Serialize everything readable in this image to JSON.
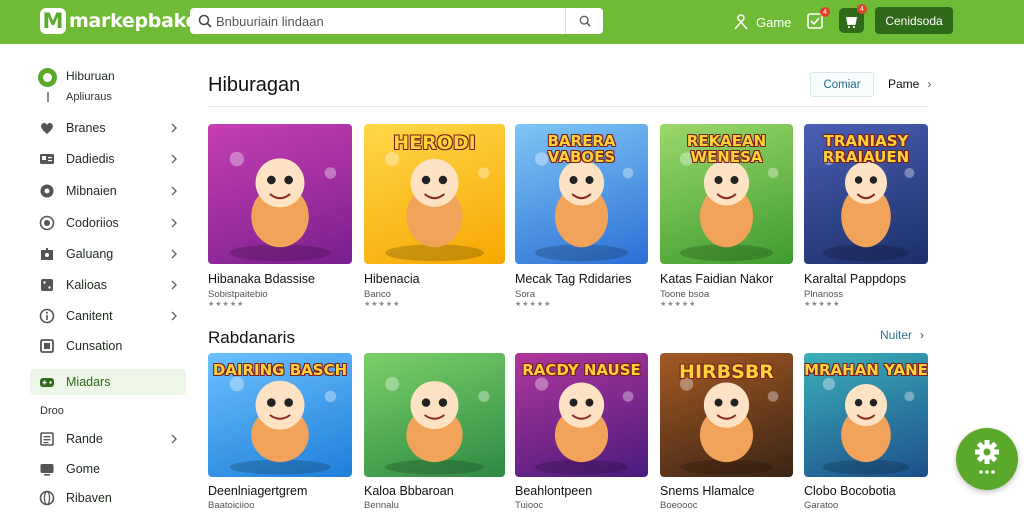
{
  "header": {
    "logo_mark": "M",
    "logo_text": "markepbake",
    "search_placeholder": "Bnbuuriain lindaan",
    "game_link": "Game",
    "notif_badge": "4",
    "cart_badge": "4",
    "cta_label": "Cenidsoda"
  },
  "sidebar": {
    "profile_name": "Hiburuan",
    "profile_sub": "Apliuraus",
    "items": [
      {
        "label": "Branes",
        "icon": "heart-icon",
        "chevron": true
      },
      {
        "label": "Dadiedis",
        "icon": "id-card-icon",
        "chevron": true
      },
      {
        "label": "Mibnaien",
        "icon": "chat-icon",
        "chevron": true
      },
      {
        "label": "Codoriios",
        "icon": "target-icon",
        "chevron": true
      },
      {
        "label": "Galuang",
        "icon": "puzzle-icon",
        "chevron": true
      },
      {
        "label": "Kalioas",
        "icon": "dice-icon",
        "chevron": true
      },
      {
        "label": "Canitent",
        "icon": "info-icon",
        "chevron": true
      },
      {
        "label": "Cunsation",
        "icon": "square-icon",
        "chevron": false
      },
      {
        "label": "Miadars",
        "icon": "controller-icon",
        "chevron": false,
        "active": true
      }
    ],
    "section_label": "Droo",
    "items2": [
      {
        "label": "Rande",
        "icon": "list-icon",
        "chevron": true
      },
      {
        "label": "Gome",
        "icon": "tv-icon",
        "chevron": false
      },
      {
        "label": "Ribaven",
        "icon": "globe-icon",
        "chevron": false
      }
    ]
  },
  "main": {
    "title": "Hiburagan",
    "tab_label": "Comiar",
    "more_label": "Pame",
    "section2_title": "Rabdanaris",
    "section2_more": "Nuiter",
    "row1": [
      {
        "title": "Hibanaka Bdassise",
        "sub": "Sobistpaitebio",
        "thumb_word": "",
        "colors": [
          "#7a1f8f",
          "#c73fb3"
        ]
      },
      {
        "title": "Hibenacia",
        "sub": "Banco",
        "thumb_word": "HERODI",
        "colors": [
          "#f6a700",
          "#ffd84a"
        ]
      },
      {
        "title": "Mecak Tag Rdidaries",
        "sub": "Sora",
        "thumb_word": "BARERA VABOES",
        "colors": [
          "#2b6fd6",
          "#7fc6f5"
        ]
      },
      {
        "title": "Katas Faidian Nakor",
        "sub": "Toone bsoa",
        "thumb_word": "REKAEAN WENESA",
        "colors": [
          "#3f9b2e",
          "#9ad86b"
        ]
      },
      {
        "title": "Karaltal Pappdops",
        "sub": "Plnanoss",
        "thumb_word": "TRANIASY RRAIAUEN",
        "colors": [
          "#1c2f6a",
          "#4a5fb3"
        ]
      }
    ],
    "row2": [
      {
        "title": "Deenlniagertgrem",
        "sub": "Baatoiciioo",
        "thumb_word": "DAIRING BASCH",
        "colors": [
          "#1e7fd9",
          "#6bc0ff"
        ]
      },
      {
        "title": "Kaloa Bbbaroan",
        "sub": "Bennalu",
        "thumb_word": "",
        "colors": [
          "#2d8a43",
          "#7ccf6a"
        ]
      },
      {
        "title": "Beahlontpeen",
        "sub": "Tuiooc",
        "thumb_word": "RACDY NAUSE",
        "colors": [
          "#4a1b7e",
          "#b0379b"
        ]
      },
      {
        "title": "Snems Hlamalce",
        "sub": "Boeoooc",
        "thumb_word": "HIRBSBR",
        "colors": [
          "#3a2414",
          "#a45a25"
        ]
      },
      {
        "title": "Clobo Bocobotia",
        "sub": "Garatoo",
        "thumb_word": "MRAHAN YANE",
        "colors": [
          "#1d4f8c",
          "#3bb0b8"
        ]
      }
    ]
  },
  "colors": {
    "brand_green": "#6fbb36",
    "dark_green": "#2f6a1a",
    "fab_green": "#5aa92a"
  }
}
